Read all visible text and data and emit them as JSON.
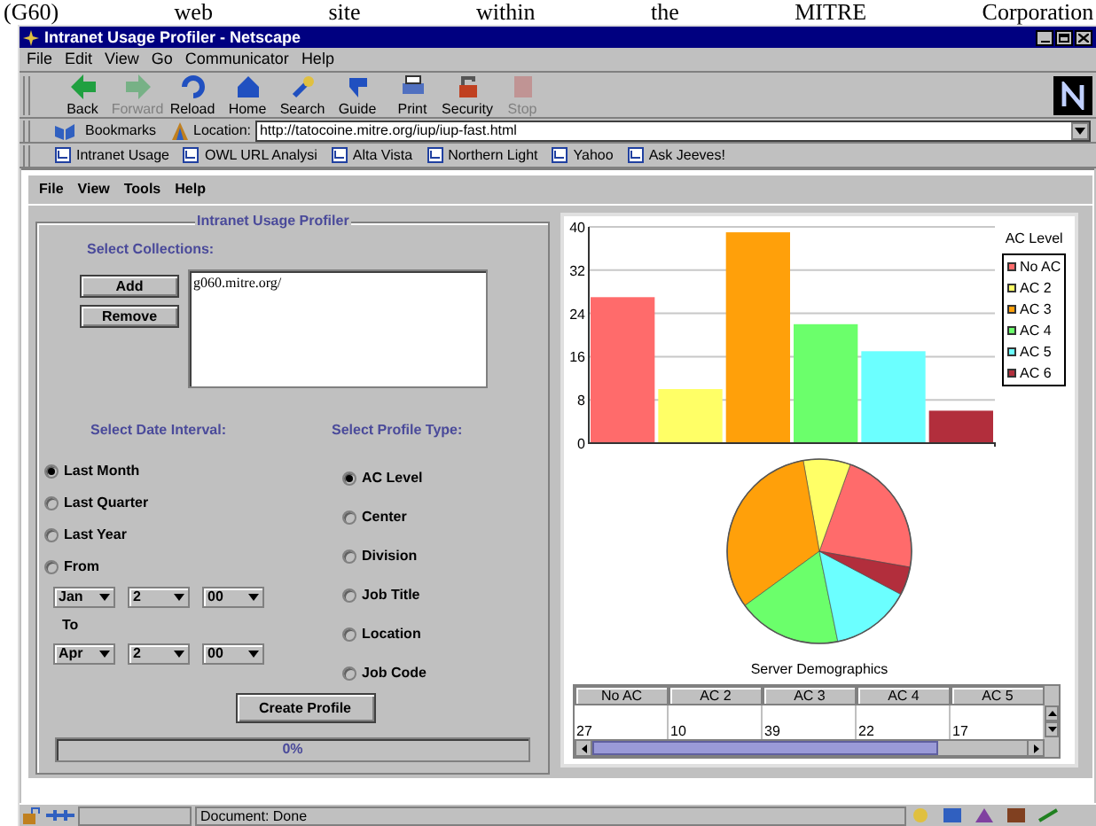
{
  "caption_text": "(G60) web site within the MITRE Corporation",
  "window": {
    "title": "Intranet Usage Profiler - Netscape"
  },
  "menu_bar": [
    "File",
    "Edit",
    "View",
    "Go",
    "Communicator",
    "Help"
  ],
  "toolbar": [
    {
      "label": "Back",
      "disabled": false
    },
    {
      "label": "Forward",
      "disabled": true
    },
    {
      "label": "Reload",
      "disabled": false
    },
    {
      "label": "Home",
      "disabled": false
    },
    {
      "label": "Search",
      "disabled": false
    },
    {
      "label": "Guide",
      "disabled": false
    },
    {
      "label": "Print",
      "disabled": false
    },
    {
      "label": "Security",
      "disabled": false
    },
    {
      "label": "Stop",
      "disabled": true
    }
  ],
  "location_bar": {
    "bookmarks": "Bookmarks",
    "label": "Location:",
    "url": "http://tatocoine.mitre.org/iup/iup-fast.html"
  },
  "personal_toolbar": [
    "Intranet Usage",
    "OWL URL Analysi",
    "Alta Vista",
    "Northern Light",
    "Yahoo",
    "Ask Jeeves!"
  ],
  "applet": {
    "menu": [
      "File",
      "View",
      "Tools",
      "Help"
    ],
    "group_title": "Intranet Usage Profiler",
    "collections": {
      "heading": "Select Collections:",
      "buttons": [
        "Add",
        "Remove"
      ],
      "items": [
        "g060.mitre.org/"
      ]
    },
    "date_interval": {
      "heading": "Select Date Interval:",
      "options": [
        {
          "label": "Last Month",
          "selected": true
        },
        {
          "label": "Last Quarter",
          "selected": false
        },
        {
          "label": "Last Year",
          "selected": false
        },
        {
          "label": "From",
          "selected": false
        }
      ],
      "from": [
        "Jan",
        "2",
        "00"
      ],
      "to_label": "To",
      "to": [
        "Apr",
        "2",
        "00"
      ]
    },
    "profile_type": {
      "heading": "Select Profile Type:",
      "options": [
        {
          "label": "AC Level",
          "selected": true
        },
        {
          "label": "Center",
          "selected": false
        },
        {
          "label": "Division",
          "selected": false
        },
        {
          "label": "Job Title",
          "selected": false
        },
        {
          "label": "Location",
          "selected": false
        },
        {
          "label": "Job Code",
          "selected": false
        }
      ]
    },
    "create_button": "Create Profile",
    "progress": {
      "level": 0,
      "text": "0%"
    }
  },
  "results": {
    "legend_title": "AC Level",
    "chart_data": {
      "type": "bar",
      "grid": true,
      "ylim": [
        0,
        40
      ],
      "yticks": [
        0,
        8,
        16,
        24,
        32,
        40
      ],
      "series": [
        {
          "name": "No AC",
          "color": "#ff6b6b",
          "values": [
            27
          ]
        },
        {
          "name": "AC 2",
          "color": "#ffff66",
          "values": [
            10
          ]
        },
        {
          "name": "AC 3",
          "color": "#ffa00a",
          "values": [
            39
          ]
        },
        {
          "name": "AC 4",
          "color": "#6bff6b",
          "values": [
            22
          ]
        },
        {
          "name": "AC 5",
          "color": "#6bffff",
          "values": [
            17
          ]
        },
        {
          "name": "AC 6",
          "color": "#b22e3c",
          "values": [
            6
          ]
        }
      ]
    },
    "pie_title": "Server Demographics",
    "table": {
      "columns": [
        "No AC",
        "AC 2",
        "AC 3",
        "AC 4",
        "AC 5"
      ],
      "rows": [
        [
          "27",
          "10",
          "39",
          "22",
          "17"
        ]
      ]
    }
  },
  "status_bar": {
    "text": "Document: Done"
  }
}
